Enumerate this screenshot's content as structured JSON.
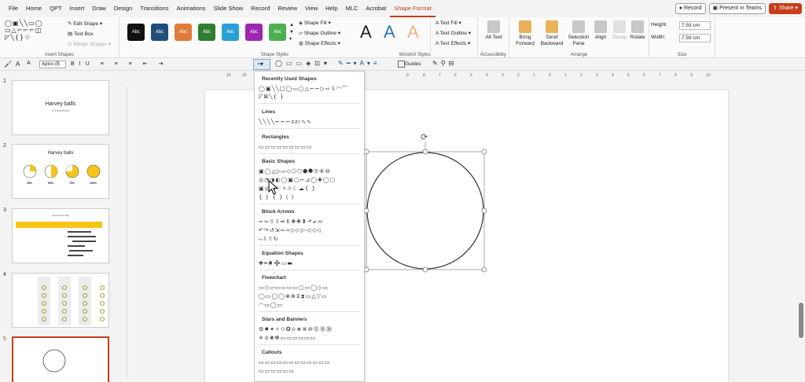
{
  "menu": {
    "tabs": [
      "File",
      "Home",
      "QPT",
      "Insert",
      "Draw",
      "Design",
      "Transitions",
      "Animations",
      "Slide Show",
      "Record",
      "Review",
      "View",
      "Help",
      "MLC",
      "Acrobat",
      "Shape Format"
    ],
    "record_label": "Record",
    "present_label": "Present in Teams",
    "share_label": "Share"
  },
  "ribbon": {
    "edit_shape": "Edit Shape",
    "text_box": "Text Box",
    "merge_shapes": "Merge Shapes",
    "insert_shapes_label": "Insert Shapes",
    "style_label": "Abc",
    "shape_styles_label": "Shape Styles",
    "shape_fill": "Shape Fill",
    "shape_outline": "Shape Outline",
    "shape_effects": "Shape Effects",
    "wordart_letter": "A",
    "text_fill": "Text Fill",
    "text_outline": "Text Outline",
    "text_effects": "Text Effects",
    "wordart_styles_label": "WordArt Styles",
    "alt_text": "Alt Text",
    "accessibility_label": "Accessibility",
    "bring_forward": "Bring Forward",
    "send_backward": "Send Backward",
    "selection_pane": "Selection Pane",
    "align": "Align",
    "group": "Group",
    "rotate": "Rotate",
    "arrange_label": "Arrange",
    "height_label": "Height:",
    "height_value": "7.59 cm",
    "width_label": "Width:",
    "width_value": "7.59 cm",
    "size_label": "Size"
  },
  "qat": {
    "font_name": "Aptos (B",
    "guides_label": "Guides"
  },
  "style_colors": [
    "#111111",
    "#1f4e79",
    "#e07b39",
    "#2e7d32",
    "#2a9fd6",
    "#9c27b0",
    "#4caf50"
  ],
  "wordart_colors": [
    "#222222",
    "#2e74b5",
    "#f4b183"
  ],
  "ruler_numbers": [
    "16",
    "15",
    "14",
    "13",
    "12",
    "11",
    "10",
    "9",
    "8",
    "7",
    "6",
    "5",
    "4",
    "3",
    "2",
    "1",
    "0",
    "1",
    "2",
    "3",
    "4",
    "5",
    "6",
    "7",
    "8",
    "9",
    "10",
    "11",
    "12",
    "13",
    "14",
    "15",
    "16"
  ],
  "slides": [
    {
      "num": "1",
      "title": "Harvey balls",
      "subtitle": "In PowerPoint"
    },
    {
      "num": "2",
      "title": "Harvey balls",
      "labels": [
        "25%",
        "50%",
        "75%",
        "100%"
      ]
    },
    {
      "num": "3",
      "title": "Gantt Chart Title"
    },
    {
      "num": "4"
    },
    {
      "num": "5"
    }
  ],
  "shapes_menu": {
    "sections": [
      "Recently Used Shapes",
      "Lines",
      "Rectangles",
      "Basic Shapes",
      "Block Arrows",
      "Equation Shapes",
      "Flowchart",
      "Stars and Banners",
      "Callouts"
    ],
    "rows": [
      "◯▣╲╲□◯▭▢△⌐⌐▷⇨⇩◠⌒",
      "◸⊠╲{ }",
      "╲╲╲╲⌐⌐⌐ƨƨɩ∿∿",
      "▭▭▭▭▭▭▭▭▭",
      "▣◯△▷▱◇⬠⬡⬢⯃⑦⑧⑩",
      "◎◔◑◐◯▣▢⌐⊿◯✚◯▢",
      "▣◎☺♡⚡☼☾☁{ }",
      "{ } { } ( )",
      "⇨⇦⇧⇩⇔⇕✥✥⬆⬏⬐⇰",
      "↶↷↺⇲⇨⇨▷▷▷◁◁◁",
      "⤷⇩⇧↻",
      "✚━✖➗▭▬",
      "▭◇▱▭▭▭▭▢▭◯◇▭",
      "◯▭◯◯⊗⊕⧖⧗▭△▽▭",
      "◠▭◯▭",
      "⚙✸✦✧✩✪✫✬⑧⑩⑫⑯⑳",
      "✯✰❀❁▭▭▭▭▭▭",
      "▭▭▭▭▭▭▭▭▭▭▭▭",
      "▭▭▭▭▭▭"
    ]
  }
}
